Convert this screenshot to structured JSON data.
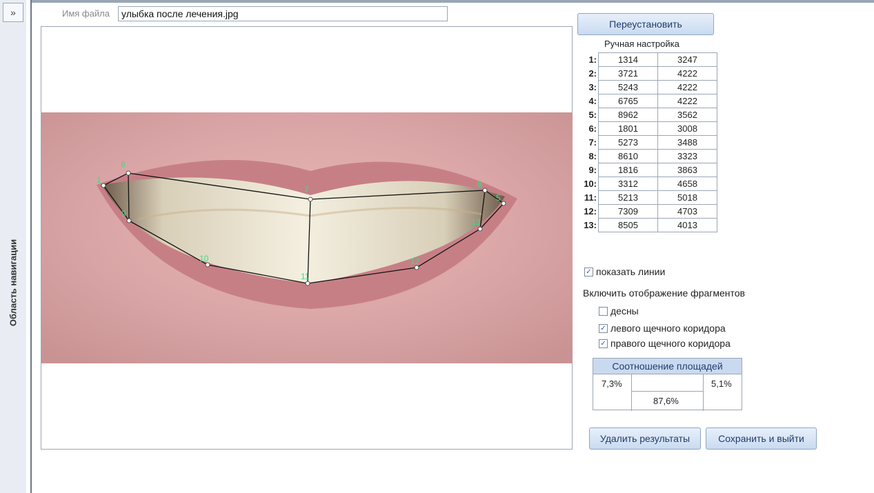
{
  "nav": {
    "toggle_icon": "»",
    "label": "Область навигации"
  },
  "file": {
    "label": "Имя файла",
    "value": "улыбка после лечения.jpg"
  },
  "buttons": {
    "reset": "Переустановить",
    "delete": "Удалить результаты",
    "save": "Сохранить и выйти"
  },
  "manual": {
    "title": "Ручная настройка",
    "rows": [
      {
        "i": "1:",
        "x": "1314",
        "y": "3247"
      },
      {
        "i": "2:",
        "x": "3721",
        "y": "4222"
      },
      {
        "i": "3:",
        "x": "5243",
        "y": "4222"
      },
      {
        "i": "4:",
        "x": "6765",
        "y": "4222"
      },
      {
        "i": "5:",
        "x": "8962",
        "y": "3562"
      },
      {
        "i": "6:",
        "x": "1801",
        "y": "3008"
      },
      {
        "i": "7:",
        "x": "5273",
        "y": "3488"
      },
      {
        "i": "8:",
        "x": "8610",
        "y": "3323"
      },
      {
        "i": "9:",
        "x": "1816",
        "y": "3863"
      },
      {
        "i": "10:",
        "x": "3312",
        "y": "4658"
      },
      {
        "i": "11:",
        "x": "5213",
        "y": "5018"
      },
      {
        "i": "12:",
        "x": "7309",
        "y": "4703"
      },
      {
        "i": "13:",
        "x": "8505",
        "y": "4013"
      }
    ]
  },
  "show_lines": {
    "label": "показать линии",
    "checked": true
  },
  "fragments": {
    "title": "Включить отображение фрагментов",
    "items": [
      {
        "label": "десны",
        "checked": false
      },
      {
        "label": "левого щечного коридора",
        "checked": true
      },
      {
        "label": "правого щечного коридора",
        "checked": true
      }
    ]
  },
  "ratio": {
    "title": "Соотношение площадей",
    "left": "7,3%",
    "right": "5,1%",
    "center": "87,6%"
  },
  "photo_labels": [
    "1",
    "6",
    "9",
    "7",
    "10",
    "11",
    "12",
    "8",
    "5",
    "13"
  ],
  "colors": {
    "accent": "#c9daf0",
    "point_label": "#3ddc84"
  }
}
